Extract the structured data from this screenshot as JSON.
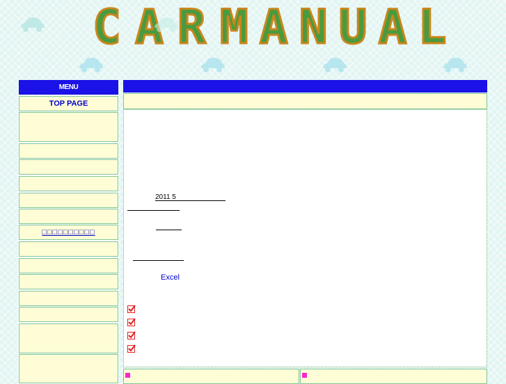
{
  "header": {
    "logo_left": "CAR",
    "logo_right": "MANUAL"
  },
  "sidebar": {
    "menu_title": "MENU",
    "items": [
      {
        "label": "TOP PAGE"
      },
      {
        "label": ""
      },
      {
        "label": ""
      },
      {
        "label": ""
      },
      {
        "label": ""
      },
      {
        "label": ""
      },
      {
        "label": ""
      },
      {
        "label": "□□□□□□□□□□"
      },
      {
        "label": ""
      },
      {
        "label": ""
      },
      {
        "label": ""
      },
      {
        "label": ""
      },
      {
        "label": ""
      },
      {
        "label": ""
      },
      {
        "label": ""
      }
    ]
  },
  "main": {
    "date_text": "2011 5",
    "excel_link": "Excel",
    "checklist_count_icons": [
      "check-icon",
      "check-icon",
      "check-icon",
      "check-icon"
    ]
  },
  "colors": {
    "header_blue": "#1a12e6",
    "cell_yellow": "#fffdd6",
    "border_green": "#7cc49b",
    "logo_green": "#4a9a3e",
    "logo_outline": "#c9871d",
    "bullet_pink": "#ff22cc",
    "check_red": "#e02020"
  }
}
